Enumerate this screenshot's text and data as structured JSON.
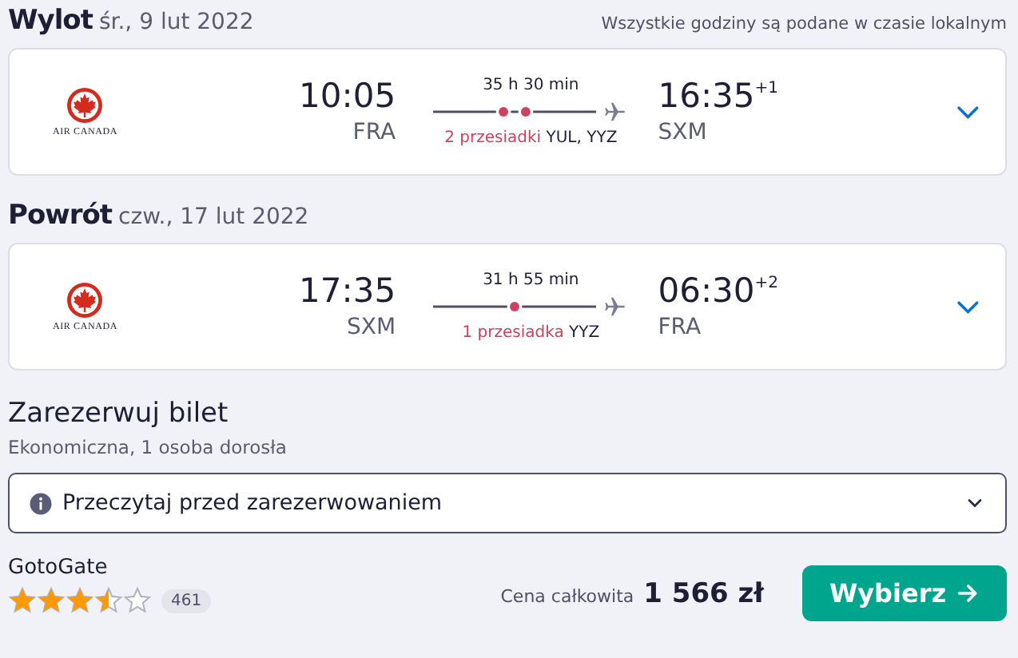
{
  "legs": [
    {
      "title": "Wylot",
      "date": "śr., 9 lut 2022",
      "note": "Wszystkie godziny są podane w czasie lokalnym",
      "airline_logo": "AIR CANADA",
      "depart_time": "10:05",
      "depart_airport": "FRA",
      "duration": "35 h 30 min",
      "stops_label": "2 przesiadki",
      "stop_airports": "YUL, YYZ",
      "arrive_time": "16:35",
      "day_offset": "+1",
      "arrive_airport": "SXM",
      "expanded": false
    },
    {
      "title": "Powrót",
      "date": "czw., 17 lut 2022",
      "airline_logo": "AIR CANADA",
      "depart_time": "17:35",
      "depart_airport": "SXM",
      "duration": "31 h 55 min",
      "stops_label": "1 przesiadka",
      "stop_airports": "YYZ",
      "arrive_time": "06:30",
      "day_offset": "+2",
      "arrive_airport": "FRA",
      "expanded": false
    }
  ],
  "booking": {
    "title": "Zarezerwuj bilet",
    "subtitle": "Ekonomiczna, 1 osoba dorosła",
    "notice": "Przeczytaj przed zarezerwowaniem",
    "notice_expanded": false,
    "provider": "GotoGate",
    "stars": 3.5,
    "review_count": "461",
    "price_label": "Cena całkowita",
    "price": "1 566 zł",
    "button": "Wybierz"
  }
}
